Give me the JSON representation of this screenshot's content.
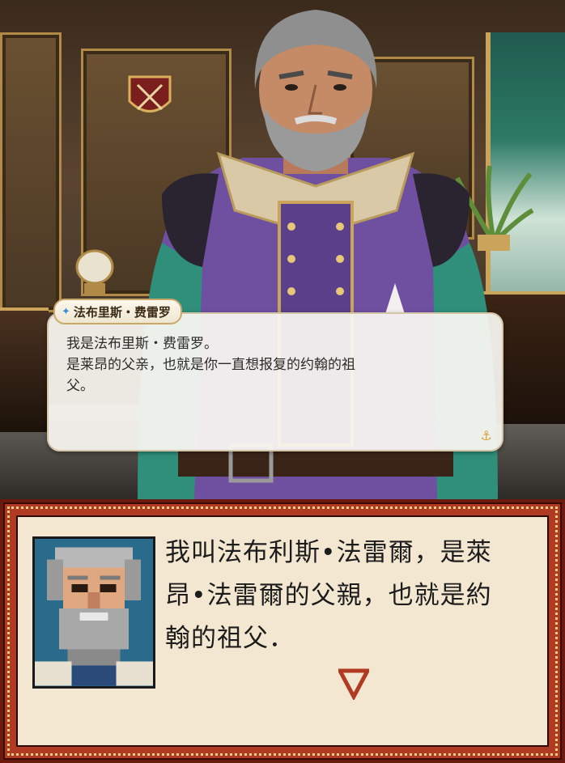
{
  "scene": {
    "speaker_name": "法布里斯・费雷罗",
    "dialogue": "我是法布里斯・费雷罗。\n是莱昂的父亲，也就是你一直想报复的约翰的祖\n父。",
    "name_icon": "diamond-icon",
    "corner_icon": "anchor-icon"
  },
  "retro_box": {
    "dialogue": "我叫法布利斯•法雷爾，是萊\n昂•法雷爾的父親，也就是約\n翰的祖父．",
    "advance_icon": "down-triangle-icon",
    "portrait_icon": "pixel-portrait-icon"
  },
  "colors": {
    "bubble_bg": "#faf8f2",
    "name_tag_border": "#c9a86a",
    "retro_frame": "#b03a22",
    "retro_paper": "#f3e7d2",
    "advance_arrow": "#b03a22"
  }
}
